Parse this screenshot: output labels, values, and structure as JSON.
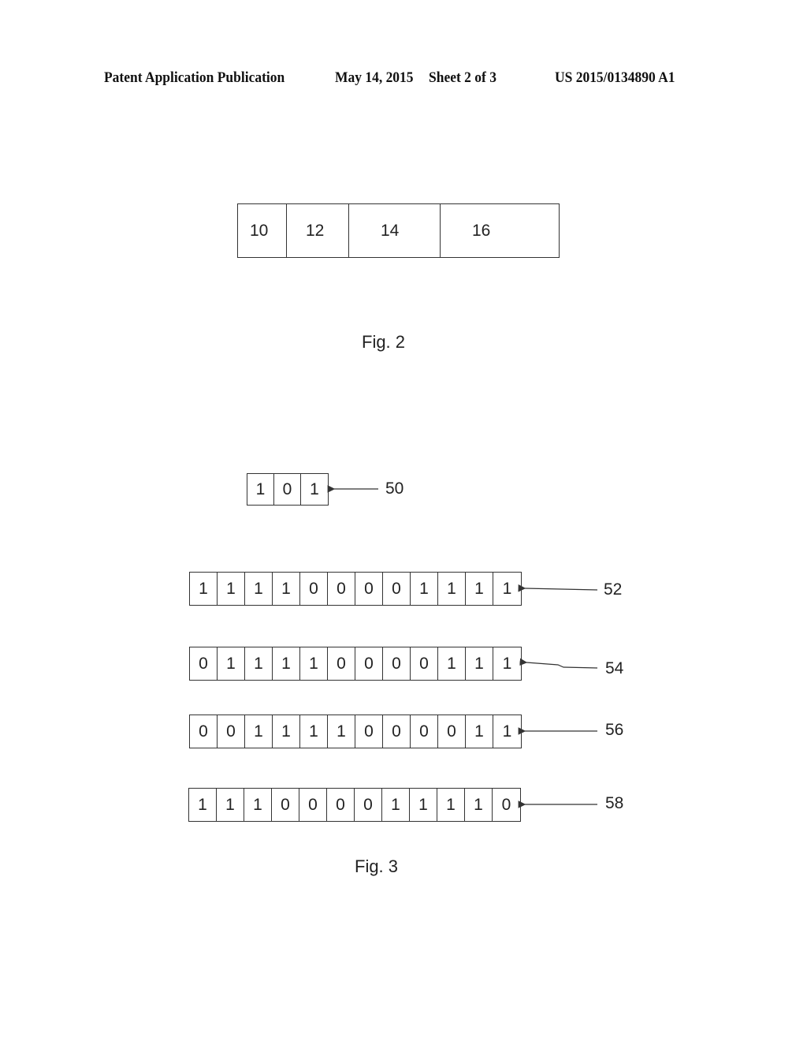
{
  "header": {
    "publication": "Patent Application Publication",
    "date": "May 14, 2015",
    "sheet": "Sheet 2 of 3",
    "number": "US 2015/0134890 A1"
  },
  "fig2": {
    "caption": "Fig. 2",
    "fields": [
      "10",
      "12",
      "14",
      "16"
    ]
  },
  "fig3": {
    "caption": "Fig. 3",
    "pattern": {
      "ref": "50",
      "bits": [
        "1",
        "0",
        "1"
      ]
    },
    "sequences": [
      {
        "ref": "52",
        "bits": [
          "1",
          "1",
          "1",
          "1",
          "0",
          "0",
          "0",
          "0",
          "1",
          "1",
          "1",
          "1"
        ]
      },
      {
        "ref": "54",
        "bits": [
          "0",
          "1",
          "1",
          "1",
          "1",
          "0",
          "0",
          "0",
          "0",
          "1",
          "1",
          "1"
        ]
      },
      {
        "ref": "56",
        "bits": [
          "0",
          "0",
          "1",
          "1",
          "1",
          "1",
          "0",
          "0",
          "0",
          "0",
          "1",
          "1"
        ]
      },
      {
        "ref": "58",
        "bits": [
          "1",
          "1",
          "1",
          "0",
          "0",
          "0",
          "0",
          "1",
          "1",
          "1",
          "1",
          "0"
        ]
      }
    ]
  }
}
